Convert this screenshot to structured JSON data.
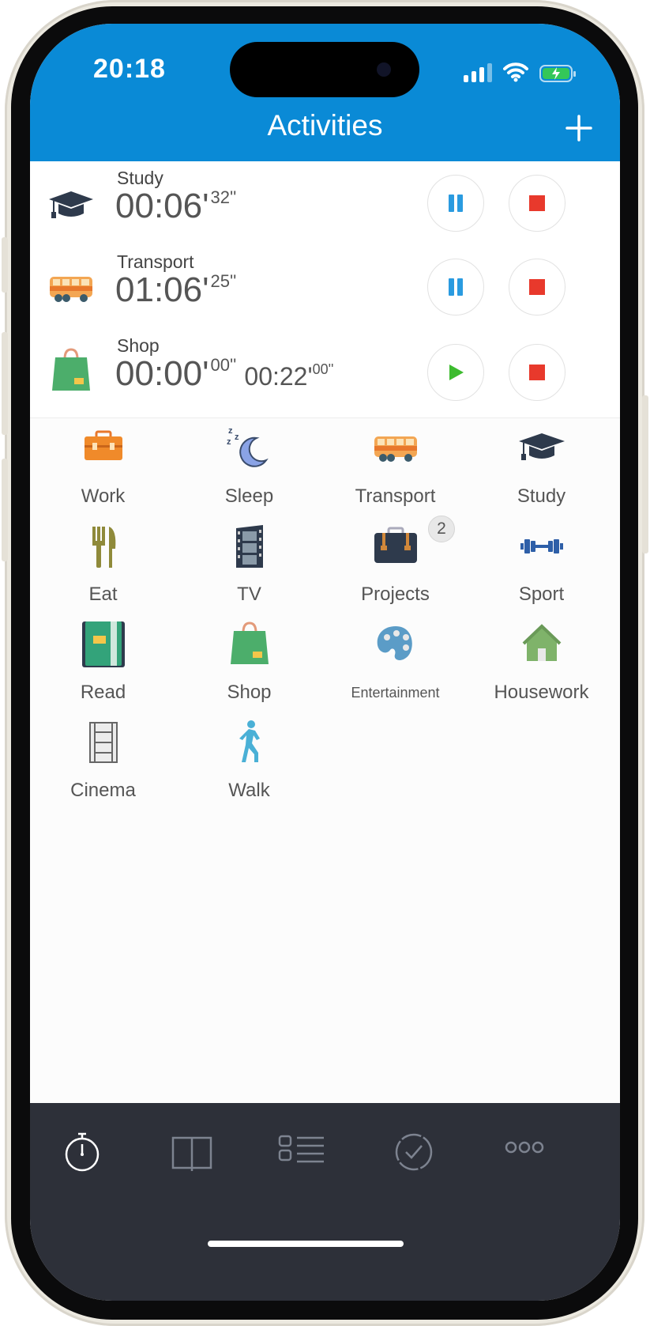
{
  "status_bar": {
    "time": "20:18"
  },
  "header": {
    "title": "Activities",
    "add_icon": "plus-icon"
  },
  "active_activities": [
    {
      "name": "Study",
      "time_main": "00:06'",
      "time_seconds": "32''",
      "icon": "graduation-cap-icon",
      "state": "running",
      "pause_or_play": "pause-icon"
    },
    {
      "name": "Transport",
      "time_main": "01:06'",
      "time_seconds": "25''",
      "icon": "bus-icon",
      "state": "running",
      "pause_or_play": "pause-icon"
    },
    {
      "name": "Shop",
      "time_main": "00:00'",
      "time_seconds": "00''",
      "time_total_main": "00:22'",
      "time_total_seconds": "00''",
      "icon": "shopping-bag-icon",
      "state": "paused",
      "pause_or_play": "play-icon"
    }
  ],
  "activity_grid": [
    {
      "label": "Work",
      "icon": "toolbox-icon"
    },
    {
      "label": "Sleep",
      "icon": "moon-icon"
    },
    {
      "label": "Transport",
      "icon": "bus-icon"
    },
    {
      "label": "Study",
      "icon": "graduation-cap-icon"
    },
    {
      "label": "Eat",
      "icon": "fork-knife-icon"
    },
    {
      "label": "TV",
      "icon": "film-strip-icon"
    },
    {
      "label": "Projects",
      "icon": "briefcase-icon",
      "badge": "2"
    },
    {
      "label": "Sport",
      "icon": "dumbbell-icon"
    },
    {
      "label": "Read",
      "icon": "book-icon"
    },
    {
      "label": "Shop",
      "icon": "shopping-bag-icon"
    },
    {
      "label": "Entertainment",
      "icon": "palette-icon"
    },
    {
      "label": "Housework",
      "icon": "house-icon"
    },
    {
      "label": "Cinema",
      "icon": "film-reel-icon"
    },
    {
      "label": "Walk",
      "icon": "walking-person-icon"
    }
  ],
  "tab_bar": [
    {
      "icon": "stopwatch-icon",
      "active": true
    },
    {
      "icon": "open-book-icon",
      "active": false
    },
    {
      "icon": "list-icon",
      "active": false
    },
    {
      "icon": "checkmark-circle-icon",
      "active": false
    },
    {
      "icon": "more-dots-icon",
      "active": false
    }
  ],
  "colors": {
    "header_blue": "#0a8ad6",
    "pause_blue": "#2a9be0",
    "stop_red": "#e8392c",
    "play_green": "#3dbb2f",
    "tabbar_bg": "#2d3039"
  }
}
